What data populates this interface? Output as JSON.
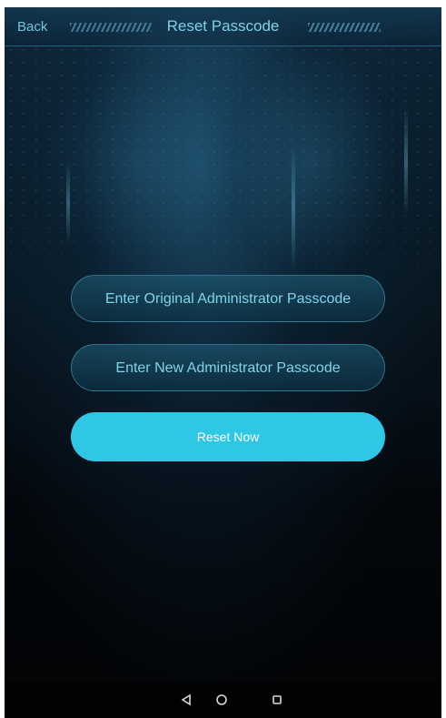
{
  "header": {
    "back_label": "Back",
    "title": "Reset Passcode"
  },
  "form": {
    "original_passcode_label": "Enter Original Administrator Passcode",
    "new_passcode_label": "Enter New Administrator Passcode",
    "reset_label": "Reset Now"
  },
  "navbar": {
    "back_icon": "triangle-back-icon",
    "home_icon": "circle-home-icon",
    "recent_icon": "square-recent-icon"
  },
  "colors": {
    "accent": "#2ec8e6",
    "text": "#7fd4ea",
    "background": "#03070b"
  }
}
